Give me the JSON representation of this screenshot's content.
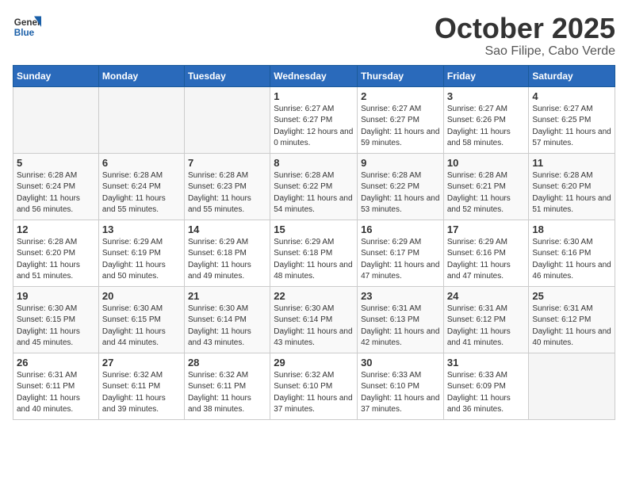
{
  "header": {
    "logo_general": "General",
    "logo_blue": "Blue",
    "month_title": "October 2025",
    "location": "Sao Filipe, Cabo Verde"
  },
  "weekdays": [
    "Sunday",
    "Monday",
    "Tuesday",
    "Wednesday",
    "Thursday",
    "Friday",
    "Saturday"
  ],
  "weeks": [
    [
      {
        "day": "",
        "info": ""
      },
      {
        "day": "",
        "info": ""
      },
      {
        "day": "",
        "info": ""
      },
      {
        "day": "1",
        "info": "Sunrise: 6:27 AM\nSunset: 6:27 PM\nDaylight: 12 hours and 0 minutes."
      },
      {
        "day": "2",
        "info": "Sunrise: 6:27 AM\nSunset: 6:27 PM\nDaylight: 11 hours and 59 minutes."
      },
      {
        "day": "3",
        "info": "Sunrise: 6:27 AM\nSunset: 6:26 PM\nDaylight: 11 hours and 58 minutes."
      },
      {
        "day": "4",
        "info": "Sunrise: 6:27 AM\nSunset: 6:25 PM\nDaylight: 11 hours and 57 minutes."
      }
    ],
    [
      {
        "day": "5",
        "info": "Sunrise: 6:28 AM\nSunset: 6:24 PM\nDaylight: 11 hours and 56 minutes."
      },
      {
        "day": "6",
        "info": "Sunrise: 6:28 AM\nSunset: 6:24 PM\nDaylight: 11 hours and 55 minutes."
      },
      {
        "day": "7",
        "info": "Sunrise: 6:28 AM\nSunset: 6:23 PM\nDaylight: 11 hours and 55 minutes."
      },
      {
        "day": "8",
        "info": "Sunrise: 6:28 AM\nSunset: 6:22 PM\nDaylight: 11 hours and 54 minutes."
      },
      {
        "day": "9",
        "info": "Sunrise: 6:28 AM\nSunset: 6:22 PM\nDaylight: 11 hours and 53 minutes."
      },
      {
        "day": "10",
        "info": "Sunrise: 6:28 AM\nSunset: 6:21 PM\nDaylight: 11 hours and 52 minutes."
      },
      {
        "day": "11",
        "info": "Sunrise: 6:28 AM\nSunset: 6:20 PM\nDaylight: 11 hours and 51 minutes."
      }
    ],
    [
      {
        "day": "12",
        "info": "Sunrise: 6:28 AM\nSunset: 6:20 PM\nDaylight: 11 hours and 51 minutes."
      },
      {
        "day": "13",
        "info": "Sunrise: 6:29 AM\nSunset: 6:19 PM\nDaylight: 11 hours and 50 minutes."
      },
      {
        "day": "14",
        "info": "Sunrise: 6:29 AM\nSunset: 6:18 PM\nDaylight: 11 hours and 49 minutes."
      },
      {
        "day": "15",
        "info": "Sunrise: 6:29 AM\nSunset: 6:18 PM\nDaylight: 11 hours and 48 minutes."
      },
      {
        "day": "16",
        "info": "Sunrise: 6:29 AM\nSunset: 6:17 PM\nDaylight: 11 hours and 47 minutes."
      },
      {
        "day": "17",
        "info": "Sunrise: 6:29 AM\nSunset: 6:16 PM\nDaylight: 11 hours and 47 minutes."
      },
      {
        "day": "18",
        "info": "Sunrise: 6:30 AM\nSunset: 6:16 PM\nDaylight: 11 hours and 46 minutes."
      }
    ],
    [
      {
        "day": "19",
        "info": "Sunrise: 6:30 AM\nSunset: 6:15 PM\nDaylight: 11 hours and 45 minutes."
      },
      {
        "day": "20",
        "info": "Sunrise: 6:30 AM\nSunset: 6:15 PM\nDaylight: 11 hours and 44 minutes."
      },
      {
        "day": "21",
        "info": "Sunrise: 6:30 AM\nSunset: 6:14 PM\nDaylight: 11 hours and 43 minutes."
      },
      {
        "day": "22",
        "info": "Sunrise: 6:30 AM\nSunset: 6:14 PM\nDaylight: 11 hours and 43 minutes."
      },
      {
        "day": "23",
        "info": "Sunrise: 6:31 AM\nSunset: 6:13 PM\nDaylight: 11 hours and 42 minutes."
      },
      {
        "day": "24",
        "info": "Sunrise: 6:31 AM\nSunset: 6:12 PM\nDaylight: 11 hours and 41 minutes."
      },
      {
        "day": "25",
        "info": "Sunrise: 6:31 AM\nSunset: 6:12 PM\nDaylight: 11 hours and 40 minutes."
      }
    ],
    [
      {
        "day": "26",
        "info": "Sunrise: 6:31 AM\nSunset: 6:11 PM\nDaylight: 11 hours and 40 minutes."
      },
      {
        "day": "27",
        "info": "Sunrise: 6:32 AM\nSunset: 6:11 PM\nDaylight: 11 hours and 39 minutes."
      },
      {
        "day": "28",
        "info": "Sunrise: 6:32 AM\nSunset: 6:11 PM\nDaylight: 11 hours and 38 minutes."
      },
      {
        "day": "29",
        "info": "Sunrise: 6:32 AM\nSunset: 6:10 PM\nDaylight: 11 hours and 37 minutes."
      },
      {
        "day": "30",
        "info": "Sunrise: 6:33 AM\nSunset: 6:10 PM\nDaylight: 11 hours and 37 minutes."
      },
      {
        "day": "31",
        "info": "Sunrise: 6:33 AM\nSunset: 6:09 PM\nDaylight: 11 hours and 36 minutes."
      },
      {
        "day": "",
        "info": ""
      }
    ]
  ]
}
